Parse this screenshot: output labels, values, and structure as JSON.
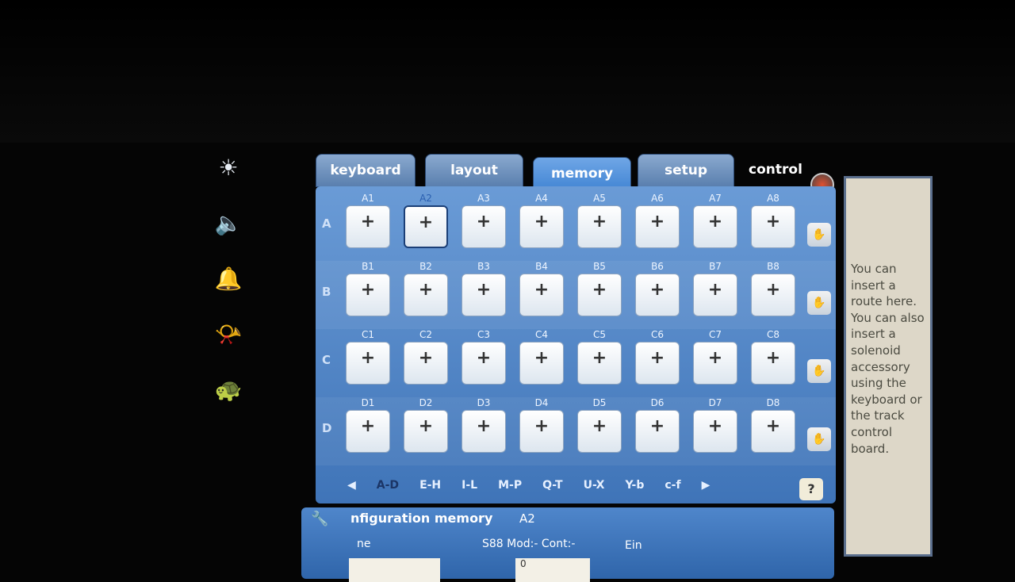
{
  "side_icons": [
    "light-icon",
    "speaker-icon",
    "bell-icon",
    "horn-icon",
    "turtle-icon"
  ],
  "tabs": [
    {
      "label": "keyboard"
    },
    {
      "label": "layout"
    },
    {
      "label": "memory",
      "active": true
    },
    {
      "label": "setup"
    },
    {
      "label": "control"
    }
  ],
  "rows": [
    {
      "label": "A",
      "cells": [
        "A1",
        "A2",
        "A3",
        "A4",
        "A5",
        "A6",
        "A7",
        "A8"
      ]
    },
    {
      "label": "B",
      "cells": [
        "B1",
        "B2",
        "B3",
        "B4",
        "B5",
        "B6",
        "B7",
        "B8"
      ]
    },
    {
      "label": "C",
      "cells": [
        "C1",
        "C2",
        "C3",
        "C4",
        "C5",
        "C6",
        "C7",
        "C8"
      ]
    },
    {
      "label": "D",
      "cells": [
        "D1",
        "D2",
        "D3",
        "D4",
        "D5",
        "D6",
        "D7",
        "D8"
      ]
    }
  ],
  "selected_cell": "A2",
  "add_glyph": "+",
  "nav": {
    "pages": [
      "A-D",
      "E-H",
      "I-L",
      "M-P",
      "Q-T",
      "U-X",
      "Y-b",
      "c-f"
    ],
    "current": "A-D",
    "help": "?"
  },
  "config": {
    "title": "nfiguration memory",
    "target": "A2",
    "name_label": "ne",
    "s88_label": "S88 Mod:- Cont:-",
    "ein_label": "Ein",
    "value": "0"
  },
  "info_text": "You can insert a route here. You can also insert a solenoid accessory using the keyboard or the track control board.",
  "colors": {
    "panel": "#4f86cb",
    "active_tab": "#3a7fd0",
    "info_bg": "#ddd7c8"
  }
}
